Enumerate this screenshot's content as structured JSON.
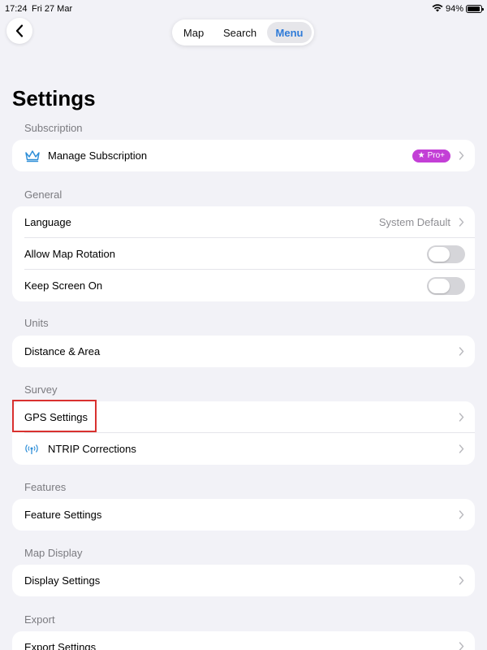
{
  "status_bar": {
    "time": "17:24",
    "date": "Fri 27 Mar",
    "battery": "94%",
    "battery_level": 0.94
  },
  "nav": {
    "tabs": [
      "Map",
      "Search",
      "Menu"
    ],
    "selected_tab": "Menu",
    "accent_color": "#2f7bd8"
  },
  "page": {
    "title": "Settings"
  },
  "sections": {
    "subscription": {
      "header": "Subscription",
      "items": [
        {
          "label": "Manage Subscription",
          "badge": "Pro+",
          "icon": "crown-icon"
        }
      ]
    },
    "general": {
      "header": "General",
      "items": [
        {
          "label": "Language",
          "value": "System Default"
        },
        {
          "label": "Allow Map Rotation",
          "toggle": false
        },
        {
          "label": "Keep Screen On",
          "toggle": false
        }
      ]
    },
    "units": {
      "header": "Units",
      "items": [
        {
          "label": "Distance & Area"
        }
      ]
    },
    "survey": {
      "header": "Survey",
      "items": [
        {
          "label": "GPS Settings"
        },
        {
          "label": "NTRIP Corrections",
          "icon": "antenna-icon"
        }
      ]
    },
    "features": {
      "header": "Features",
      "items": [
        {
          "label": "Feature Settings"
        }
      ]
    },
    "map_display": {
      "header": "Map Display",
      "items": [
        {
          "label": "Display Settings"
        }
      ]
    },
    "export": {
      "header": "Export",
      "items": [
        {
          "label": "Export Settings"
        }
      ]
    }
  },
  "colors": {
    "badge": "#c33fd6",
    "highlight": "#d9312f",
    "icon_blue": "#2f8fd8"
  }
}
